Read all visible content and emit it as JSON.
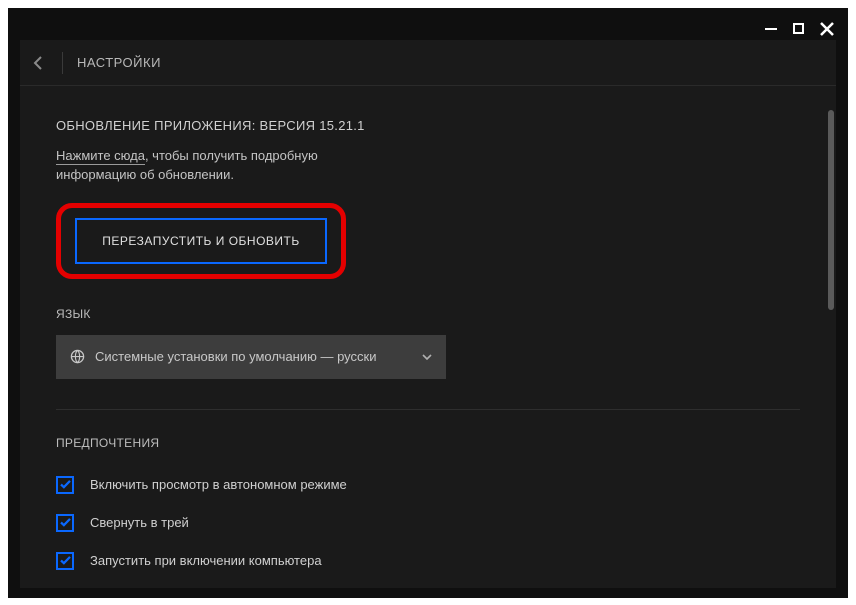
{
  "window": {
    "title": "НАСТРОЙКИ"
  },
  "update": {
    "heading": "ОБНОВЛЕНИЕ ПРИЛОЖЕНИЯ: ВЕРСИЯ 15.21.1",
    "click_here": "Нажмите сюда",
    "desc_suffix": ", чтобы получить подробную информацию об обновлении.",
    "restart_label": "ПЕРЕЗАПУСТИТЬ И ОБНОВИТЬ"
  },
  "language": {
    "section_label": "ЯЗЫК",
    "selected": "Системные установки по умолчанию — русски"
  },
  "preferences": {
    "section_label": "ПРЕДПОЧТЕНИЯ",
    "items": [
      {
        "label": "Включить просмотр в автономном режиме",
        "checked": true
      },
      {
        "label": "Свернуть в трей",
        "checked": true
      },
      {
        "label": "Запустить при включении компьютера",
        "checked": true
      }
    ]
  }
}
